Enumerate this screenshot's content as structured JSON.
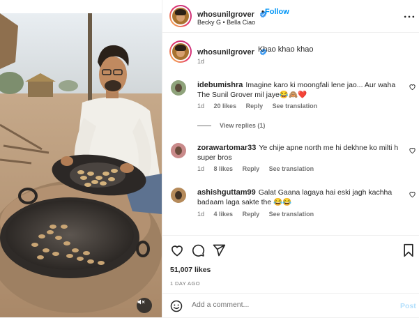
{
  "post": {
    "author": "whosunilgrover",
    "follow_label": "Follow",
    "separator": "•",
    "audio": "Becky G • Bella Ciao",
    "caption": "Khao khao khao",
    "caption_time": "1d",
    "likes": "51,007 likes",
    "date": "1 DAY AGO"
  },
  "comments": [
    {
      "user": "idebumishra",
      "text": "Imagine karo ki moongfali lene jao... Aur waha The Sunil Grover mil jaye😂🙈❤️",
      "time": "1d",
      "likes": "20 likes",
      "reply": "Reply",
      "translate": "See translation"
    },
    {
      "user": "zorawartomar33",
      "text": "Ye chije apne north me hi dekhne ko milti h super bros",
      "time": "1d",
      "likes": "8 likes",
      "reply": "Reply",
      "translate": "See translation"
    },
    {
      "user": "ashishguttam99",
      "text": "Galat Gaana lagaya hai eski jagh kachha badaam laga sakte the 😂😂",
      "time": "1d",
      "likes": "4 likes",
      "reply": "Reply",
      "translate": "See translation"
    }
  ],
  "view_replies": "View replies (1)",
  "add_comment": {
    "placeholder": "Add a comment...",
    "post_label": "Post"
  },
  "icons": {
    "verified": "verified-badge-icon",
    "more": "more-options-icon",
    "like": "heart-icon",
    "comment": "comment-icon",
    "share": "share-icon",
    "save": "bookmark-icon",
    "emoji": "emoji-icon",
    "mute": "muted-speaker-icon"
  },
  "colors": {
    "accent": "#0095f6",
    "verified": "#3897f0",
    "heart": "#ed4956"
  }
}
